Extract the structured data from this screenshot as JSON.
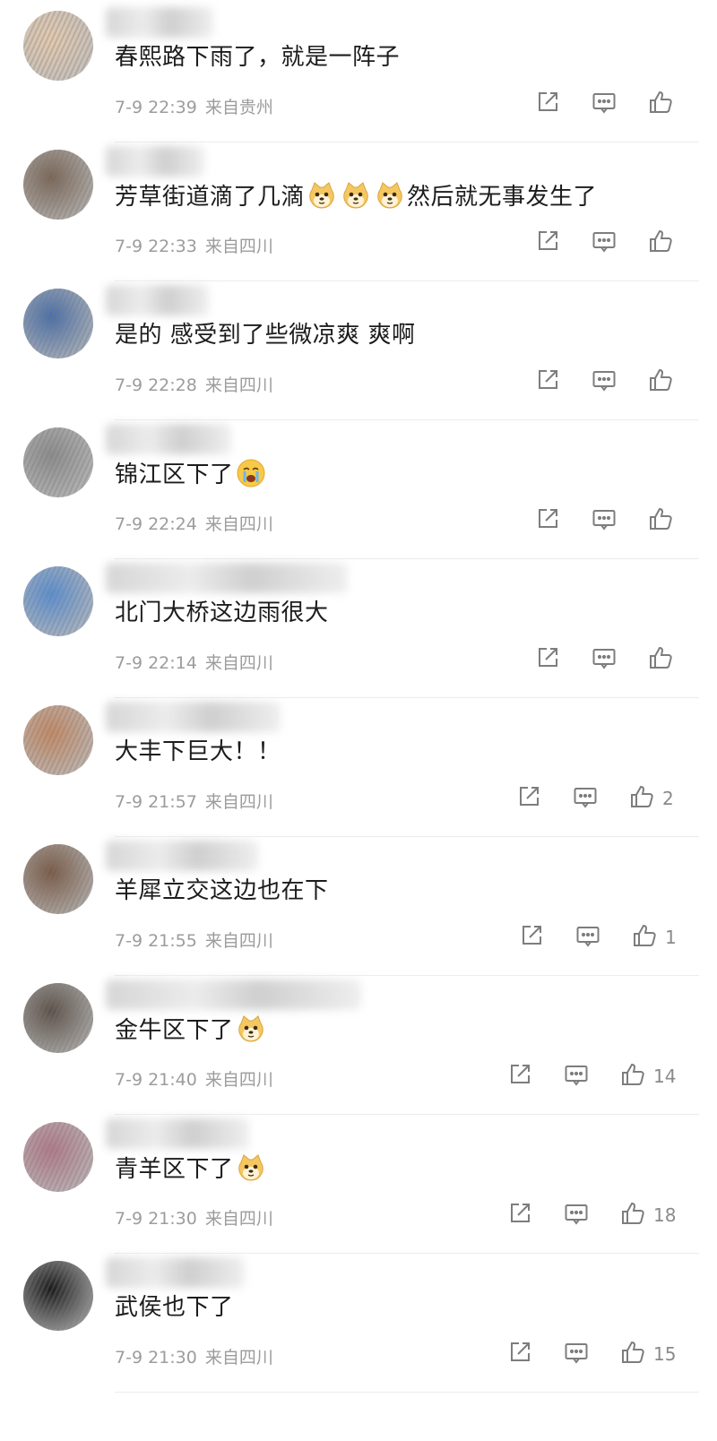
{
  "comments": [
    {
      "text": "春熙路下雨了，就是一阵子",
      "emoji_count": 0,
      "emoji_type": "",
      "time": "7-9 22:39",
      "location": "来自贵州",
      "likes": "",
      "avatar_color": "#e4c9ae",
      "name_width": 120
    },
    {
      "text": "芳草街道滴了几滴",
      "emoji_count": 3,
      "emoji_type": "doge",
      "suffix": "然后就无事发生了",
      "time": "7-9 22:33",
      "location": "来自四川",
      "likes": "",
      "avatar_color": "#7a6656",
      "name_width": 110
    },
    {
      "text": "是的 感受到了些微凉爽 爽啊",
      "emoji_count": 0,
      "emoji_type": "",
      "time": "7-9 22:28",
      "location": "来自四川",
      "likes": "",
      "avatar_color": "#4a6fa8",
      "name_width": 115
    },
    {
      "text": "锦江区下了",
      "emoji_count": 1,
      "emoji_type": "crying",
      "time": "7-9 22:24",
      "location": "来自四川",
      "likes": "",
      "avatar_color": "#8c8c8c",
      "name_width": 140
    },
    {
      "text": "北门大桥这边雨很大",
      "emoji_count": 0,
      "emoji_type": "",
      "time": "7-9 22:14",
      "location": "来自四川",
      "likes": "",
      "avatar_color": "#5b8fd1",
      "name_width": 270
    },
    {
      "text": "大丰下巨大！！",
      "emoji_count": 0,
      "emoji_type": "",
      "time": "7-9 21:57",
      "location": "来自四川",
      "likes": "2",
      "avatar_color": "#c48a66",
      "name_width": 195
    },
    {
      "text": "羊犀立交这边也在下",
      "emoji_count": 0,
      "emoji_type": "",
      "time": "7-9 21:55",
      "location": "来自四川",
      "likes": "1",
      "avatar_color": "#7a5a45",
      "name_width": 170
    },
    {
      "text": "金牛区下了",
      "emoji_count": 1,
      "emoji_type": "doge",
      "time": "7-9 21:40",
      "location": "来自四川",
      "likes": "14",
      "avatar_color": "#5c5148",
      "name_width": 285
    },
    {
      "text": "青羊区下了",
      "emoji_count": 1,
      "emoji_type": "doge",
      "time": "7-9 21:30",
      "location": "来自四川",
      "likes": "18",
      "avatar_color": "#b27a8a",
      "name_width": 160
    },
    {
      "text": "武侯也下了",
      "emoji_count": 0,
      "emoji_type": "",
      "time": "7-9 21:30",
      "location": "来自四川",
      "likes": "15",
      "avatar_color": "#1a1a1a",
      "name_width": 155
    }
  ],
  "icons": {
    "share": "share-icon",
    "reply": "comment-icon",
    "like": "thumbs-up-icon"
  },
  "colors": {
    "text": "#1c1c1c",
    "meta": "#9c9c9c",
    "icon": "#7d7d7d",
    "emoji": "#f7c948"
  }
}
